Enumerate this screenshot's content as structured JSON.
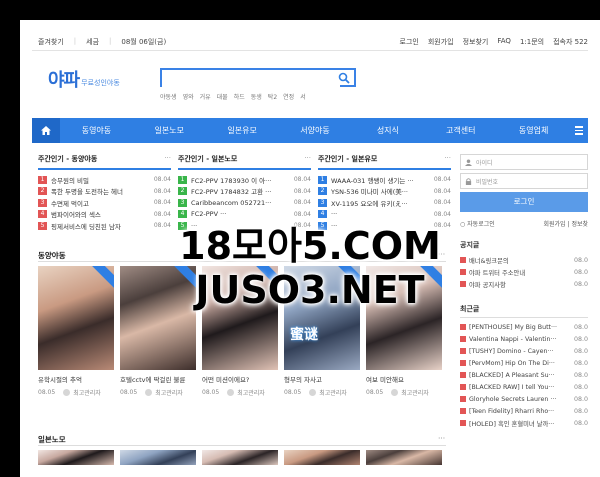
{
  "topbar": {
    "bookmark": "즐겨찾기",
    "tax": "세금",
    "date": "08월 06일(금)",
    "login": "로그인",
    "register": "회원가입",
    "find": "정보찾기",
    "faq": "FAQ",
    "qna": "1:1문의",
    "visitors": "접속자 522"
  },
  "logo": {
    "main": "야파",
    "sub": "무료성인야동"
  },
  "search": {
    "value": ""
  },
  "tags": [
    "야동생",
    "영와",
    "거유",
    "대물",
    "하드",
    "동생",
    "탁2",
    "연정",
    "서"
  ],
  "nav": [
    "동영야동",
    "일본노모",
    "일본유모",
    "서양야동",
    "성지식",
    "고객센터",
    "동영업체"
  ],
  "weekly_korean": {
    "title": "주간인기 - 동양야동",
    "more": "···",
    "items": [
      {
        "n": "1",
        "text": "승무원의 비밀",
        "date": "08.04"
      },
      {
        "n": "2",
        "text": "폭한 두명을 도전하는 헤너",
        "date": "08.04"
      },
      {
        "n": "3",
        "text": "수면제 먹이고",
        "date": "08.04"
      },
      {
        "n": "4",
        "text": "범파이어와의 섹스",
        "date": "08.04"
      },
      {
        "n": "5",
        "text": "핑제서비스에 딩친된 남자",
        "date": "08.04"
      }
    ]
  },
  "weekly_jp_nomo": {
    "title": "주간인기 - 일본노모",
    "more": "···",
    "items": [
      {
        "n": "1",
        "text": "FC2-PPV 1783930 이 아···",
        "date": "08.04"
      },
      {
        "n": "2",
        "text": "FC2-PPV 1784832 고환 ···",
        "date": "08.04"
      },
      {
        "n": "3",
        "text": "Caribbeancom 052721···",
        "date": "08.04"
      },
      {
        "n": "4",
        "text": "FC2-PPV ···",
        "date": "08.04"
      },
      {
        "n": "5",
        "text": "···",
        "date": "08.04"
      }
    ]
  },
  "weekly_jp_yumo": {
    "title": "주간인기 - 일본유모",
    "more": "···",
    "items": [
      {
        "n": "1",
        "text": "WAAA-031 행쌩이 생기는 ···",
        "date": "08.04"
      },
      {
        "n": "2",
        "text": "YSN-536 미나미 사에(美···",
        "date": "08.04"
      },
      {
        "n": "3",
        "text": "XV-1195 요오에 유키(え···",
        "date": "08.04"
      },
      {
        "n": "4",
        "text": "···",
        "date": "08.04"
      },
      {
        "n": "5",
        "text": "···",
        "date": "08.04"
      }
    ]
  },
  "section_korean": {
    "title": "동양야동",
    "more": "···"
  },
  "cards": [
    {
      "caption": "유학시절의 추억",
      "date": "08.05",
      "author": "최고관리자"
    },
    {
      "caption": "호텔cctv에 딱걸린 불륜",
      "date": "08.05",
      "author": "최고관리자"
    },
    {
      "caption": "어떤 미션이에요?",
      "date": "08.05",
      "author": "최고관리자"
    },
    {
      "caption": "형부의 자사고",
      "date": "08.05",
      "author": "최고관리자"
    },
    {
      "caption": "여보 미안해요",
      "date": "08.05",
      "author": "최고관리자"
    }
  ],
  "card_logo_text": "蜜谜",
  "section_jp_nomo": {
    "title": "일본노모",
    "more": "···"
  },
  "sidebar": {
    "id_placeholder": "아이디",
    "pw_placeholder": "비밀번호",
    "login_btn": "로그인",
    "auto_login": "자동로그인",
    "join": "회원가입",
    "find": "정보찾",
    "notice_title": "공지글",
    "notices": [
      {
        "text": "배너&링크문의",
        "date": "08.0"
      },
      {
        "text": "야파 트위터 주소안내",
        "date": "08.0"
      },
      {
        "text": "야파 공지사항",
        "date": "08.0"
      }
    ],
    "recent_title": "최근글",
    "recent": [
      {
        "text": "[PENTHOUSE] My Big Butt···",
        "date": "08.0"
      },
      {
        "text": "Valentina Nappi - Valentin···",
        "date": "08.0"
      },
      {
        "text": "[TUSHY] Domino - Cayen···",
        "date": "08.0"
      },
      {
        "text": "[PervMom] Hip On The Di···",
        "date": "08.0"
      },
      {
        "text": "[BLACKED] A Pleasant Su···",
        "date": "08.0"
      },
      {
        "text": "[BLACKED RAW] I tell You···",
        "date": "08.0"
      },
      {
        "text": "Gloryhole Secrets Lauren ···",
        "date": "08.0"
      },
      {
        "text": "[Teen Fidelity] Rharri Rho···",
        "date": "08.0"
      },
      {
        "text": "[HOLED] 흑인 혼혈미녀 날까···",
        "date": "08.0"
      }
    ]
  },
  "watermark": {
    "line1": "18모아5.COM",
    "line2": "JUSO3.NET"
  },
  "colors": {
    "accent": "#2f7fe3",
    "rank_red": "#e25555",
    "rank_green": "#39b54a",
    "rank_blue": "#2f7fe3"
  }
}
